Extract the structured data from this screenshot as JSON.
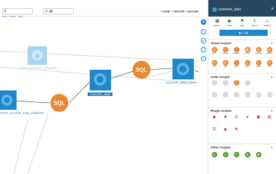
{
  "toolbar": {
    "search_value": "",
    "filter_value": "all",
    "legend": [
      "Item",
      "Zones",
      "Tags"
    ],
    "zone_label": "+ ZONE",
    "recipe_label": "+ RECIPE",
    "dataset_label": "+ DATASET"
  },
  "flow": {
    "nodes": [
      {
        "label": "SFDC_customer_prepared",
        "state": "faded"
      },
      {
        "label": "customer_data",
        "state": "selected"
      },
      {
        "label": "customer_data_joined",
        "state": "normal"
      },
      {
        "label": "SFDC_account_copy_prepared",
        "state": "normal"
      }
    ],
    "recipe_label": "SQL"
  },
  "panel": {
    "title": "customer_data",
    "actions": [
      "Explore",
      "Build",
      "Flag",
      "Export",
      "Publish"
    ],
    "run_label": "▶  LAB",
    "sections": [
      {
        "title": "Visual recipes",
        "items": [
          "Sync",
          "Prepare",
          "Sample",
          "Group",
          "Window",
          "Distinct",
          "Join",
          "Split",
          "Fuzzy",
          "Pivot",
          "Stack",
          "Sort"
        ]
      },
      {
        "title": "Code recipes",
        "items": [
          "",
          "",
          "",
          "",
          "",
          "",
          "",
          "",
          "",
          "",
          "",
          ""
        ]
      },
      {
        "title": "Plugin recipes",
        "items": [
          "",
          "",
          "",
          "",
          "",
          "",
          "",
          "",
          "",
          "",
          "",
          "",
          "",
          ""
        ]
      },
      {
        "title": "Other recipes",
        "items": [
          "",
          "",
          "",
          "",
          ""
        ]
      }
    ]
  },
  "colors": {
    "accent": "#1f86c9",
    "recipe": "#e8892f",
    "panel_header": "#26475f"
  }
}
